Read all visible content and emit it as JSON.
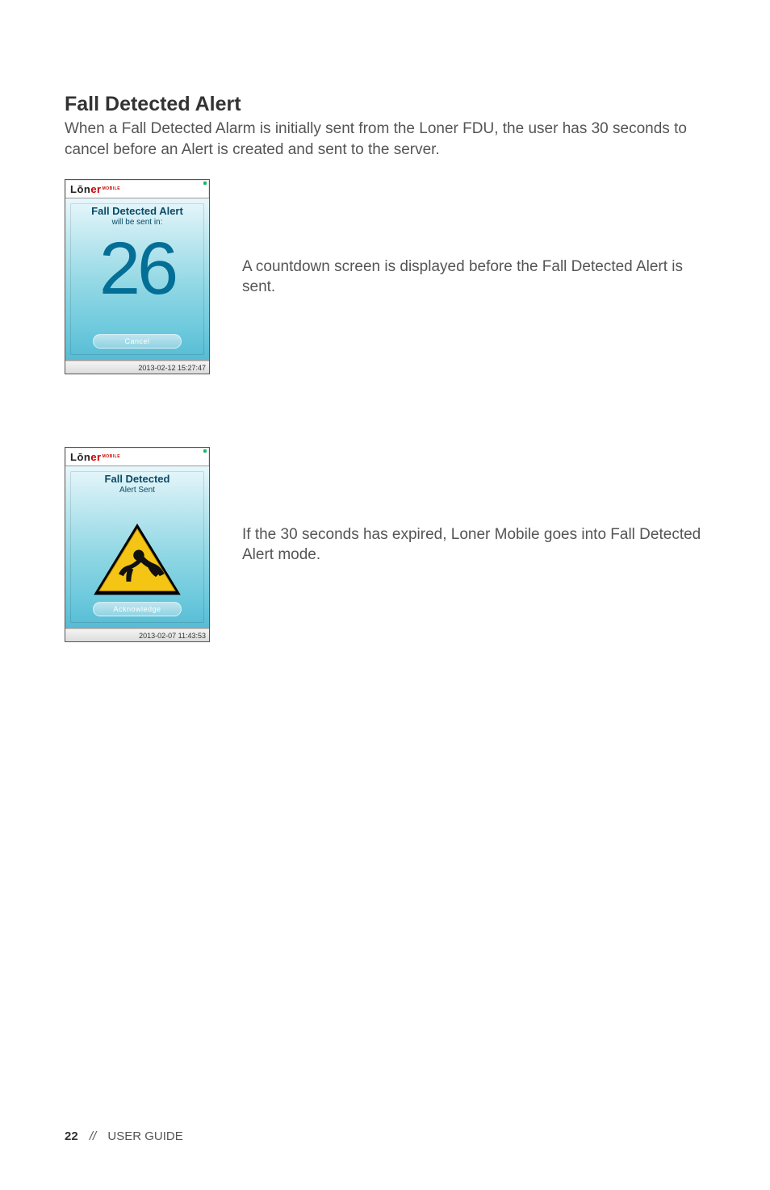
{
  "heading": "Fall Detected Alert",
  "intro": "When a Fall Detected Alarm is initially sent from the Loner FDU, the user has 30 seconds to cancel before an Alert is created and sent to the server.",
  "brand_prefix": "Lōn",
  "brand_suffix": "er",
  "brand_sub": "MOBILE",
  "shot1": {
    "line1": "Fall Detected Alert",
    "line2": "will be sent in:",
    "countdown": "26",
    "button": "Cancel",
    "timestamp": "2013-02-12 15:27:47"
  },
  "caption1": "A countdown screen is displayed before the Fall Detected Alert is sent.",
  "shot2": {
    "line1": "Fall Detected",
    "line2": "Alert Sent",
    "button": "Acknowledge",
    "timestamp": "2013-02-07 11:43:53"
  },
  "caption2": "If the 30 seconds has expired, Loner Mobile goes into Fall Detected Alert mode.",
  "footer_page": "22",
  "footer_sep": "//",
  "footer_label": "USER GUIDE"
}
